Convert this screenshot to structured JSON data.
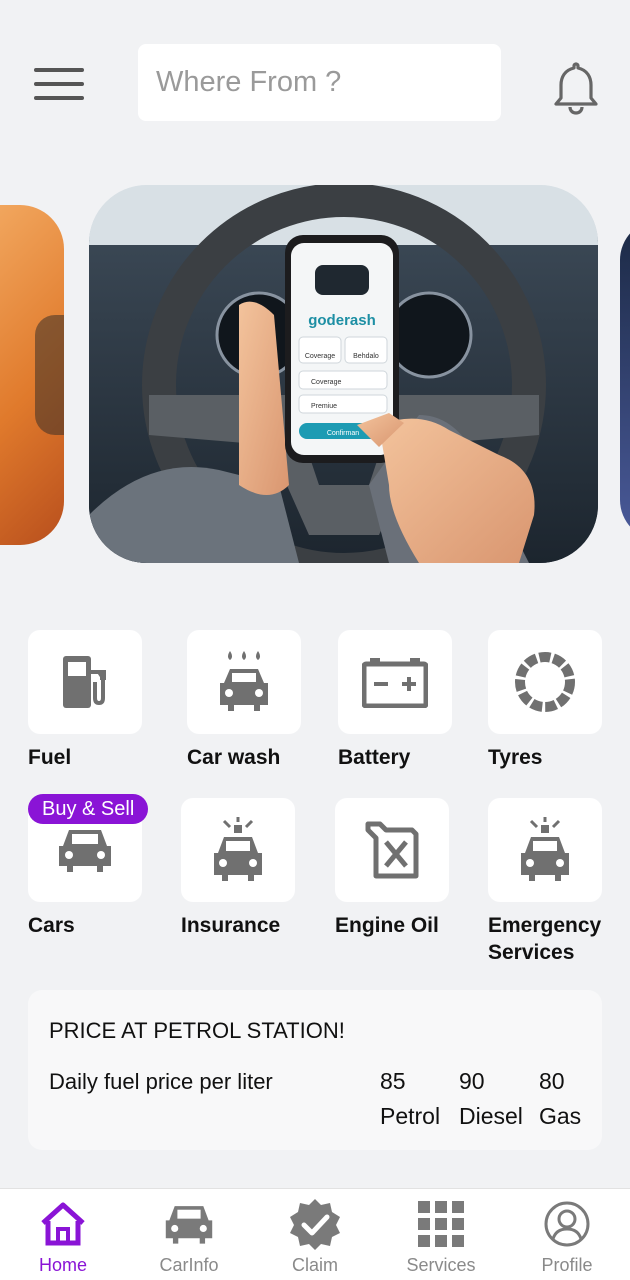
{
  "header": {
    "search_placeholder": "Where From ?"
  },
  "icons": {
    "menu": "hamburger-menu-icon",
    "notifications": "bell-icon"
  },
  "banner": {
    "brand_text": "goderash",
    "phone_buttons": [
      "Coverage",
      "Behdalo"
    ],
    "phone_rows": [
      "Coverage",
      "Premiue"
    ],
    "confirm_label": "Confirman"
  },
  "categories": [
    {
      "label": "Fuel",
      "icon": "fuel-pump-icon"
    },
    {
      "label": "Car wash",
      "icon": "car-wash-icon"
    },
    {
      "label": "Battery",
      "icon": "battery-icon"
    },
    {
      "label": "Tyres",
      "icon": "tyre-icon"
    },
    {
      "label": "Cars",
      "icon": "car-icon",
      "badge": "Buy & Sell"
    },
    {
      "label": "Insurance",
      "icon": "siren-car-icon"
    },
    {
      "label": "Engine Oil",
      "icon": "oil-can-icon"
    },
    {
      "label": "Emergency Services",
      "icon": "siren-car-icon"
    }
  ],
  "price_card": {
    "title": "PRICE AT PETROL STATION!",
    "subtitle": "Daily fuel price per liter",
    "prices": [
      {
        "value": "85",
        "fuel": "Petrol"
      },
      {
        "value": "90",
        "fuel": "Diesel"
      },
      {
        "value": "80",
        "fuel": "Gas"
      }
    ]
  },
  "bottom_nav": [
    {
      "label": "Home",
      "icon": "home-icon",
      "active": true
    },
    {
      "label": "CarInfo",
      "icon": "car-icon",
      "active": false
    },
    {
      "label": "Claim",
      "icon": "verified-badge-icon",
      "active": false
    },
    {
      "label": "Services",
      "icon": "grid-icon",
      "active": false
    },
    {
      "label": "Profile",
      "icon": "user-icon",
      "active": false
    }
  ],
  "colors": {
    "accent": "#8a14d6",
    "icon_gray": "#707070",
    "background": "#f1f2f4"
  }
}
